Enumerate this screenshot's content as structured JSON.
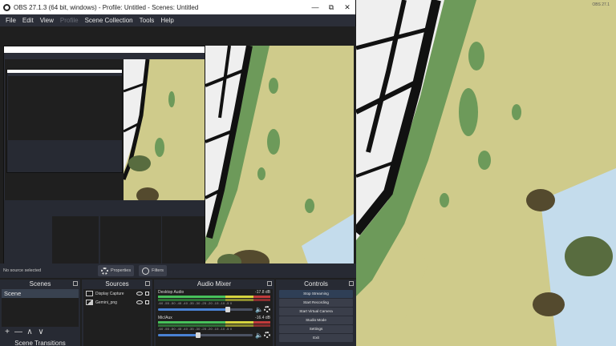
{
  "window": {
    "title": "OBS 27.1.3 (64 bit, windows) - Profile: Untitled - Scenes: Untitled",
    "controls": {
      "minimize": "—",
      "maximize": "⧉",
      "close": "✕"
    }
  },
  "menu": [
    {
      "label": "File",
      "enabled": true
    },
    {
      "label": "Edit",
      "enabled": true
    },
    {
      "label": "View",
      "enabled": true
    },
    {
      "label": "Profile",
      "enabled": false
    },
    {
      "label": "Scene Collection",
      "enabled": true
    },
    {
      "label": "Tools",
      "enabled": true
    },
    {
      "label": "Help",
      "enabled": true
    }
  ],
  "source_bar": {
    "no_source": "No source selected",
    "properties": "Properties",
    "filters": "Filters"
  },
  "scenes": {
    "title": "Scenes",
    "items": [
      "Scene"
    ],
    "toolbar": {
      "add": "+",
      "remove": "—",
      "up": "∧",
      "down": "∨"
    }
  },
  "transitions": {
    "title": "Scene Transitions"
  },
  "sources": {
    "title": "Sources",
    "items": [
      {
        "name": "Display Capture",
        "type": "monitor"
      },
      {
        "name": "Gemini_png",
        "type": "image"
      }
    ]
  },
  "mixer": {
    "title": "Audio Mixer",
    "scale": "-60 -55 -50 -45 -40 -35 -30 -25 -20 -15 -10 -5 0",
    "channels": [
      {
        "name": "Desktop Audio",
        "level": "-17.8 dB",
        "volume": 0.74
      },
      {
        "name": "Mic/Aux",
        "level": "-16.4 dB",
        "volume": 0.42
      }
    ]
  },
  "controls": {
    "title": "Controls",
    "buttons": [
      "Stop Streaming",
      "Start Recording",
      "Start Virtual Camera",
      "Studio Mode",
      "Settings",
      "Exit"
    ]
  },
  "background": {
    "label": "OBS 27.1"
  },
  "colors": {
    "obs_panel": "#2b2e38",
    "land": "#cfcb8b",
    "green": "#6d9a5a",
    "dark_green": "#586c3f",
    "brown": "#544a2e",
    "water": "#c4dcec",
    "road": "#111111",
    "block": "#efefef"
  }
}
